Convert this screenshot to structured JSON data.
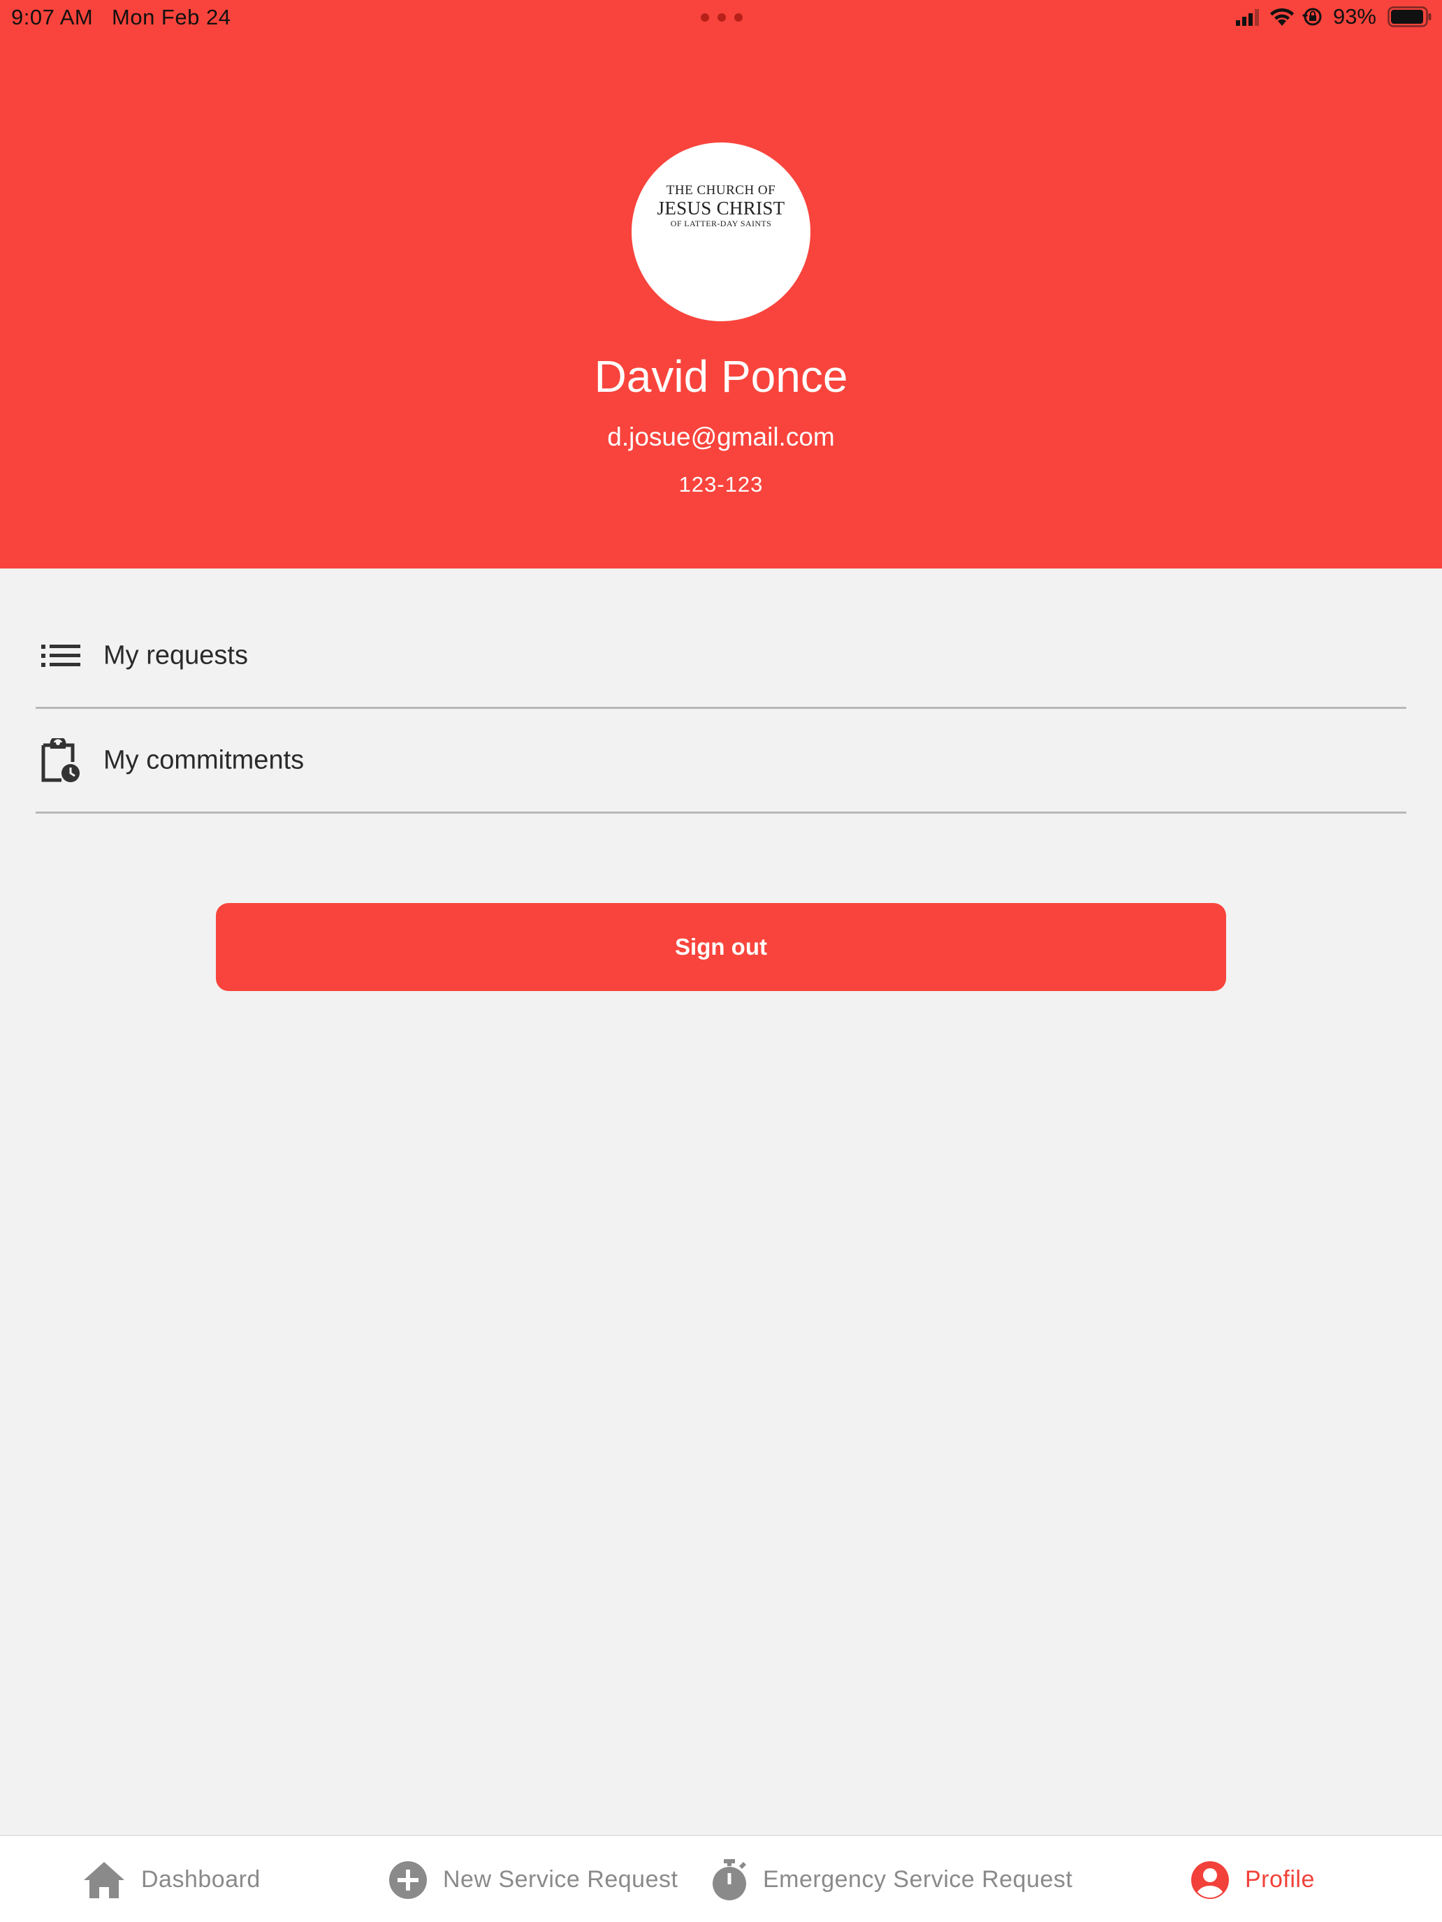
{
  "status_bar": {
    "time": "9:07 AM",
    "date": "Mon Feb 24",
    "battery": "93%"
  },
  "profile": {
    "logo_line1": "THE CHURCH OF",
    "logo_line2": "JESUS CHRIST",
    "logo_line3": "OF LATTER-DAY SAINTS",
    "name": "David Ponce",
    "email": "d.josue@gmail.com",
    "phone": "123-123"
  },
  "menu": {
    "items": [
      {
        "label": "My requests",
        "icon": "list-icon"
      },
      {
        "label": "My commitments",
        "icon": "clipboard-clock-icon"
      }
    ]
  },
  "actions": {
    "sign_out": "Sign out"
  },
  "tabbar": {
    "active": "Profile",
    "tabs": [
      {
        "label": "Dashboard",
        "icon": "home-icon"
      },
      {
        "label": "New Service Request",
        "icon": "plus-circle-icon"
      },
      {
        "label": "Emergency Service Request",
        "icon": "stopwatch-icon"
      },
      {
        "label": "Profile",
        "icon": "account-circle-icon"
      }
    ]
  },
  "colors": {
    "brand": "#f8443c",
    "background": "#f2f2f2",
    "tab_inactive": "#8a8a8a",
    "tab_active": "#f1413a"
  }
}
